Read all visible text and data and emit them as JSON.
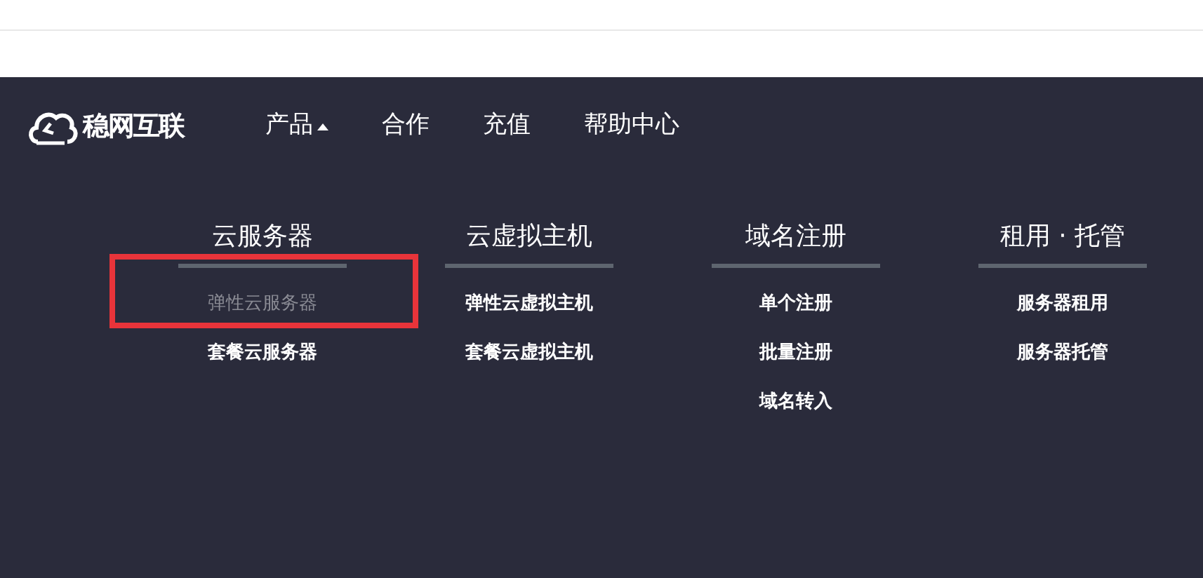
{
  "brand": {
    "name": "稳网互联"
  },
  "nav": [
    {
      "label": "产品",
      "expanded": true
    },
    {
      "label": "合作"
    },
    {
      "label": "充值"
    },
    {
      "label": "帮助中心"
    }
  ],
  "menu_columns": [
    {
      "heading": "云服务器",
      "items": [
        {
          "label": "弹性云服务器",
          "highlighted": true
        },
        {
          "label": "套餐云服务器",
          "highlighted": false
        }
      ]
    },
    {
      "heading": "云虚拟主机",
      "items": [
        {
          "label": "弹性云虚拟主机",
          "highlighted": false
        },
        {
          "label": "套餐云虚拟主机",
          "highlighted": false
        }
      ]
    },
    {
      "heading": "域名注册",
      "items": [
        {
          "label": "单个注册",
          "highlighted": false
        },
        {
          "label": "批量注册",
          "highlighted": false
        },
        {
          "label": "域名转入",
          "highlighted": false
        }
      ]
    },
    {
      "heading": "租用 · 托管",
      "items": [
        {
          "label": "服务器租用",
          "highlighted": false
        },
        {
          "label": "服务器托管",
          "highlighted": false
        }
      ]
    }
  ]
}
